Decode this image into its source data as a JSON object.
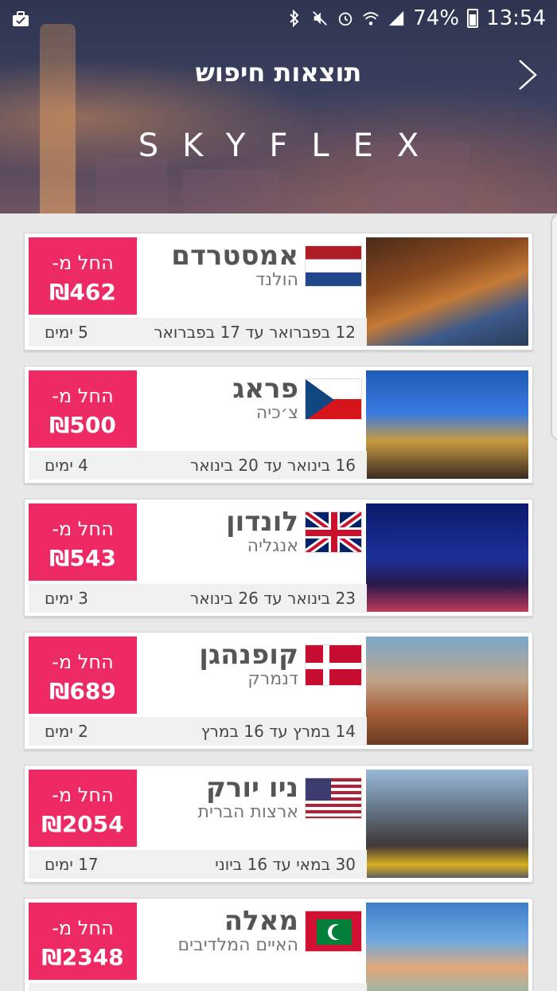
{
  "status_bar": {
    "battery": "74%",
    "time": "13:54"
  },
  "header": {
    "title": "תוצאות חיפוש",
    "brand": "SKYFLEX"
  },
  "results": [
    {
      "city": "אמסטרדם",
      "country": "הולנד",
      "price_label": "החל מ-",
      "price": "₪462",
      "dates": "12 בפברואר עד 17 בפברואר",
      "days": "5 ימים",
      "flag": "netherlands-flag",
      "photo": "amsterdam-photo"
    },
    {
      "city": "פראג",
      "country": "צ׳כיה",
      "price_label": "החל מ-",
      "price": "₪500",
      "dates": "16 בינואר עד 20 בינואר",
      "days": "4 ימים",
      "flag": "czech-flag",
      "photo": "prague-photo"
    },
    {
      "city": "לונדון",
      "country": "אנגליה",
      "price_label": "החל מ-",
      "price": "₪543",
      "dates": "23 בינואר עד 26 בינואר",
      "days": "3 ימים",
      "flag": "uk-flag",
      "photo": "london-photo"
    },
    {
      "city": "קופנהגן",
      "country": "דנמרק",
      "price_label": "החל מ-",
      "price": "₪689",
      "dates": "14 במרץ עד 16 במרץ",
      "days": "2 ימים",
      "flag": "denmark-flag",
      "photo": "copenhagen-photo"
    },
    {
      "city": "ניו יורק",
      "country": "ארצות הברית",
      "price_label": "החל מ-",
      "price": "₪2054",
      "dates": "30 במאי עד 16 ביוני",
      "days": "17 ימים",
      "flag": "usa-flag",
      "photo": "new-york-photo"
    },
    {
      "city": "מאלה",
      "country": "האיים המלדיבים",
      "price_label": "החל מ-",
      "price": "₪2348",
      "dates": "",
      "days": "",
      "flag": "maldives-flag",
      "photo": "maldives-photo"
    }
  ],
  "colors": {
    "accent": "#ee2a64",
    "header_bg": "#3b3f5e",
    "list_bg": "#e8e8e8"
  }
}
